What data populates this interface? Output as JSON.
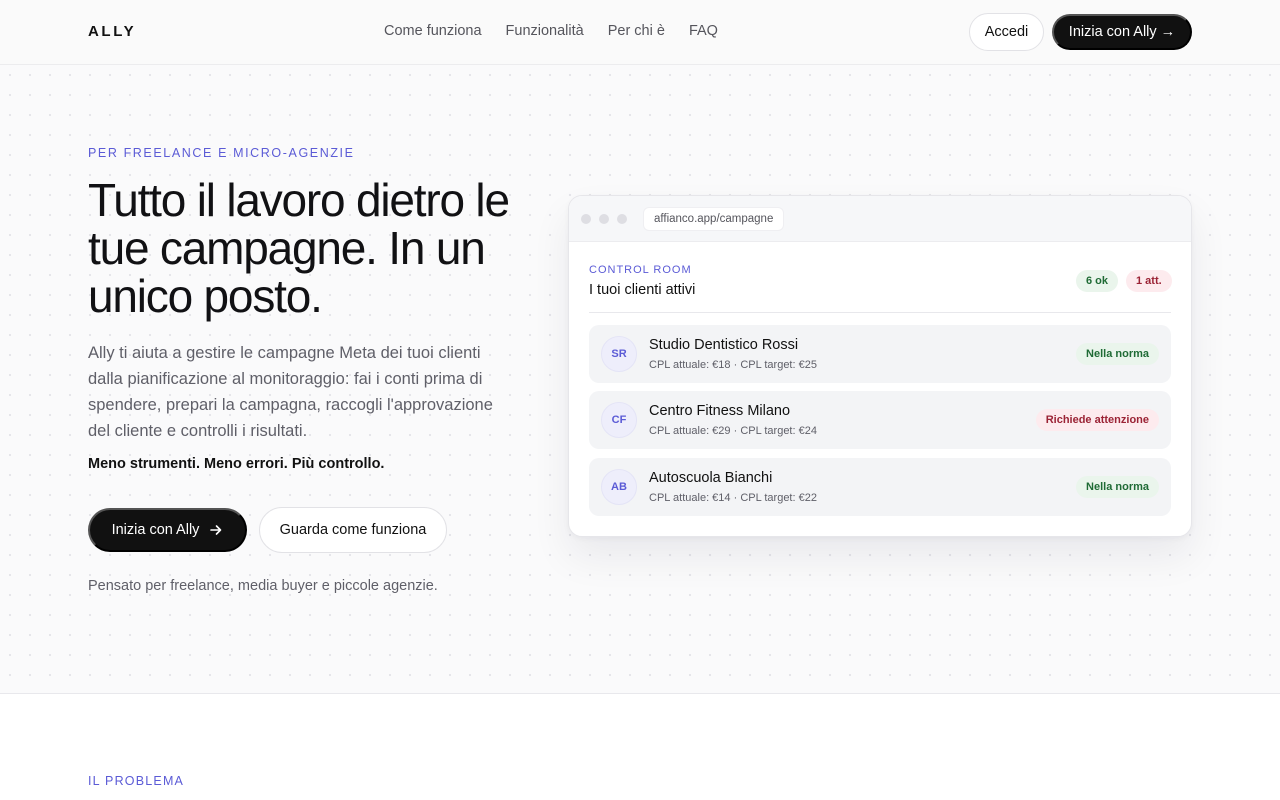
{
  "header": {
    "logo": "ALLY",
    "nav": [
      "Come funziona",
      "Funzionalità",
      "Per chi è",
      "FAQ"
    ],
    "login_label": "Accedi",
    "start_label": "Inizia con Ally →"
  },
  "hero": {
    "eyebrow": "PER FREELANCE E MICRO-AGENZIE",
    "title": "Tutto il lavoro dietro le tue campagne. In un unico posto.",
    "description": "Ally ti aiuta a gestire le campagne Meta dei tuoi clienti dalla pianificazione al monitoraggio: fai i conti prima di spendere, prepari la campagna, raccogli l'approvazione del cliente e controlli i risultati.",
    "tagline": "Meno strumenti. Meno errori. Più controllo.",
    "primary_label": "Inizia con Ally",
    "primary_icon": "arrow-right-icon",
    "secondary_label": "Guarda come funziona",
    "footnote": "Pensato per freelance, media buyer e piccole agenzie."
  },
  "mock": {
    "url": "affianco.app/campagne",
    "label": "CONTROL ROOM",
    "title": "I tuoi clienti attivi",
    "ok_pill": "6 ok",
    "att_pill": "1 att.",
    "clients": [
      {
        "initials": "SR",
        "name": "Studio Dentistico Rossi",
        "details": "CPL attuale: €18 · CPL target: €25",
        "status": "Nella norma",
        "status_type": "ok"
      },
      {
        "initials": "CF",
        "name": "Centro Fitness Milano",
        "details": "CPL attuale: €29 · CPL target: €24",
        "status": "Richiede attenzione",
        "status_type": "warn"
      },
      {
        "initials": "AB",
        "name": "Autoscuola Bianchi",
        "details": "CPL attuale: €14 · CPL target: €22",
        "status": "Nella norma",
        "status_type": "ok"
      }
    ]
  },
  "next_section": {
    "eyebrow": "IL PROBLEMA"
  },
  "colors": {
    "accent": "#5b5bd6",
    "primary_button": "#111111",
    "ok": "#1f6b35",
    "warn": "#9b2335"
  }
}
